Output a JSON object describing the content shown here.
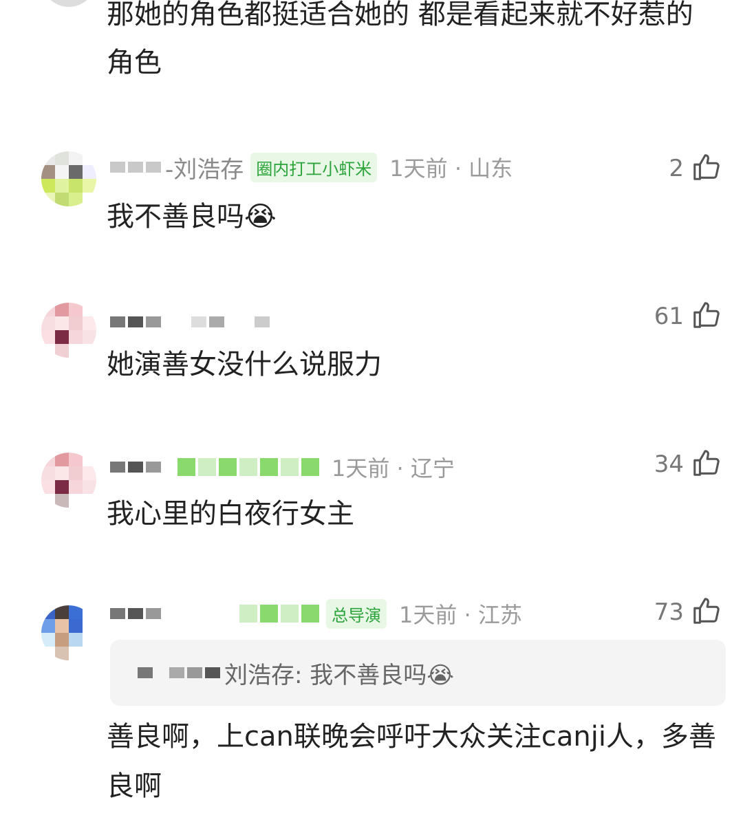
{
  "comments": [
    {
      "text": "那她的角色都挺适合她的 都是看起来就不好惹的角色"
    },
    {
      "username": "-刘浩存",
      "badge": "圈内打工小虾米",
      "time_location": "1天前 · 山东",
      "likes": "2",
      "text": "我不善良吗😭"
    },
    {
      "likes": "61",
      "text": "她演善女没什么说服力"
    },
    {
      "time_location": "1天前 · 辽宁",
      "likes": "34",
      "text": "我心里的白夜行女主"
    },
    {
      "badge": "总导演",
      "time_location": "1天前 · 江苏",
      "likes": "73",
      "reply_quote": "刘浩存: 我不善良吗😭",
      "text": "善良啊，上can联晚会呼吁大众关注canji人，多善良啊"
    }
  ],
  "icons": {
    "like": "thumbs-up-icon"
  }
}
